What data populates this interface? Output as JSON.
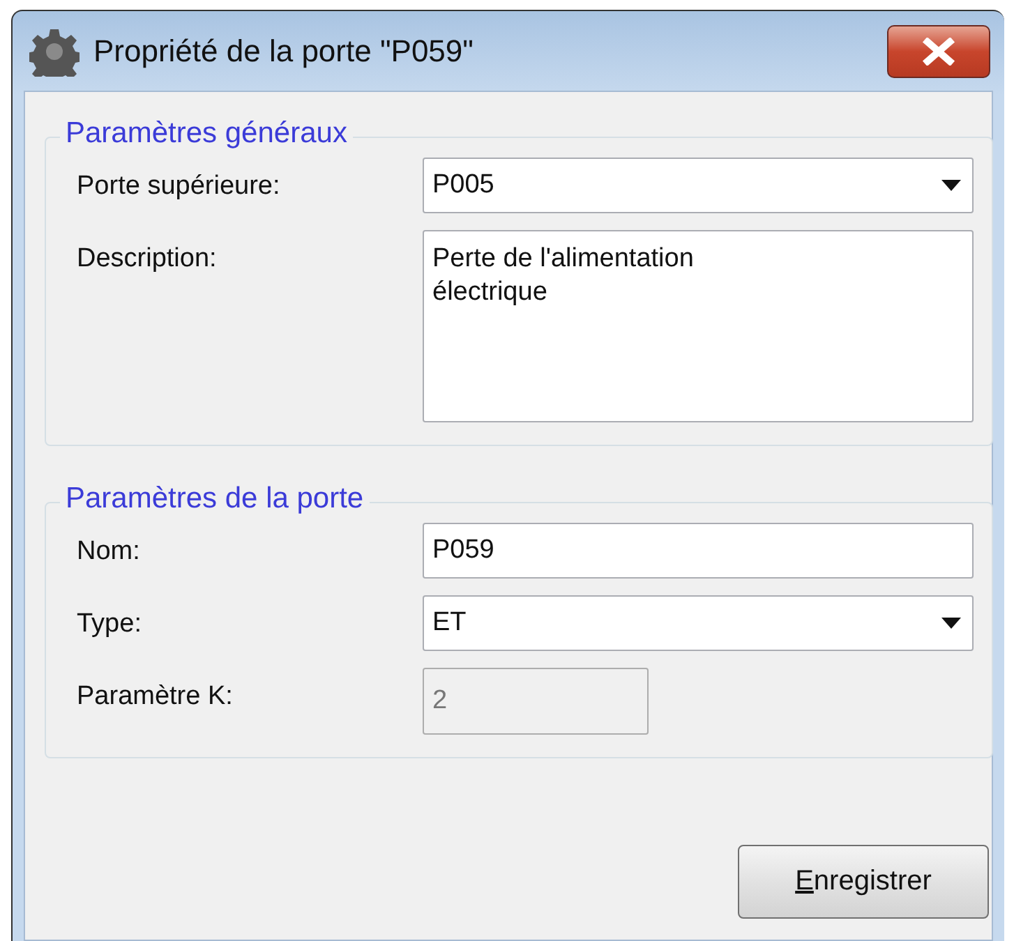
{
  "window": {
    "title": "Propriété de la porte \"P059\""
  },
  "groups": [
    {
      "title": "Paramètres généraux",
      "fields": [
        {
          "kind": "combo",
          "label": "Porte supérieure:",
          "value": "P005"
        },
        {
          "kind": "textarea",
          "label": "Description:",
          "value": "Perte de l'alimentation électrique"
        }
      ]
    },
    {
      "title": "Paramètres de la porte",
      "fields": [
        {
          "kind": "text",
          "label": "Nom:",
          "value": "P059",
          "disabled": false
        },
        {
          "kind": "combo",
          "label": "Type:",
          "value": "ET"
        },
        {
          "kind": "text",
          "label": "Paramètre K:",
          "value": "2",
          "disabled": true
        }
      ]
    }
  ],
  "buttons": [
    {
      "label": "Enregistrer"
    }
  ]
}
